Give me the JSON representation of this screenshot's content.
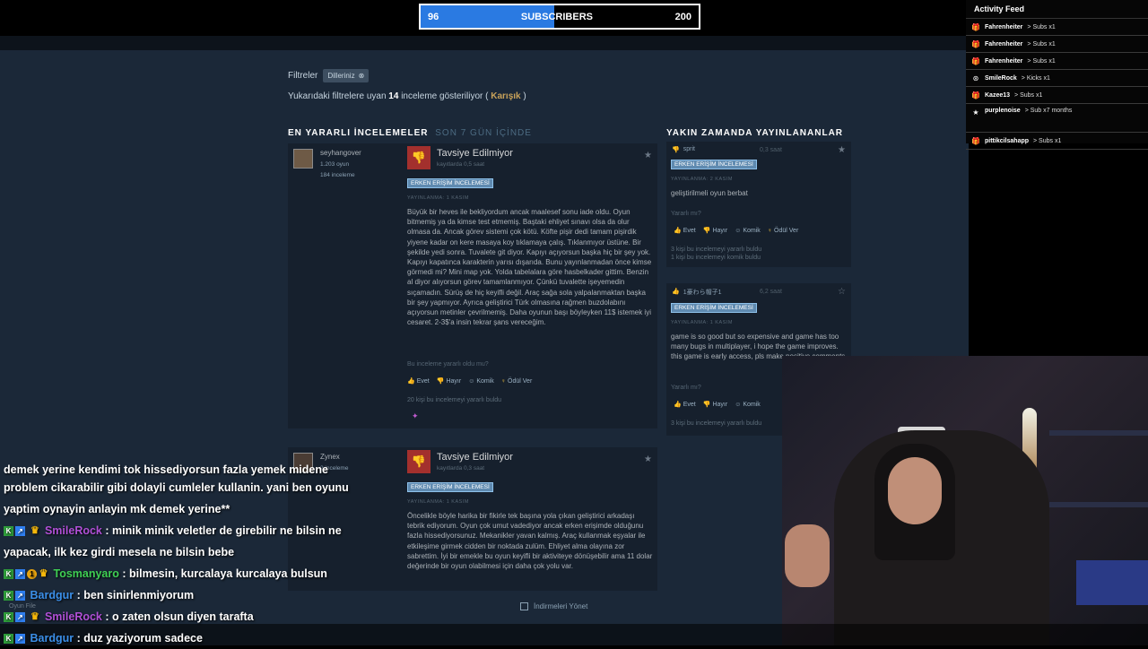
{
  "subscribers": {
    "current": "96",
    "label": "SUBSCRIBERS",
    "goal": "200",
    "progress": 0.48
  },
  "activity_feed": {
    "title": "Activity Feed",
    "items": [
      {
        "user": "Fahrenheiter",
        "action": "> Subs x1",
        "icon": "gift-icon"
      },
      {
        "user": "Fahrenheiter",
        "action": "> Subs x1",
        "icon": "gift-icon"
      },
      {
        "user": "Fahrenheiter",
        "action": "> Subs x1",
        "icon": "gift-icon"
      },
      {
        "user": "SmileRock",
        "action": "> Kicks x1",
        "icon": "kick-icon"
      },
      {
        "user": "Kazee13",
        "action": "> Subs x1",
        "icon": "gift-icon"
      },
      {
        "user": "purplenoise",
        "action": "> Sub x7 months",
        "icon": "star-icon"
      },
      {
        "user": "pittikcilsahapp",
        "action": "> Subs x1",
        "icon": "gift-icon"
      }
    ]
  },
  "filters": {
    "label": "Filtreler",
    "chip": "Dilleriniz",
    "chip_close": "⊗"
  },
  "showing": {
    "prefix": "Yukarıdaki filtrelere uyan",
    "count": "14",
    "suffix": "inceleme gösteriliyor (",
    "mix": "Karışık",
    "close": ")"
  },
  "section_main": {
    "title": "EN YARARLI İNCELEMELER",
    "sub": "SON 7 GÜN İÇİNDE"
  },
  "section_side": {
    "title": "YAKIN ZAMANDA YAYINLANANLAR"
  },
  "reviews": [
    {
      "author": "seyhangover",
      "games": "1.203 oyun",
      "reviews": "184 inceleme",
      "verdict": "Tavsiye Edilmiyor",
      "time": "kayıtlarda 0,5 saat",
      "badge": "ERKEN ERİŞİM İNCELEMESİ",
      "posted": "YAYINLANMA: 1 KASIM",
      "text": "Büyük bir heves ile bekliyordum ancak maalesef sonu iade oldu. Oyun bitmemiş ya da kimse test etmemiş. Baştaki ehliyet sınavı olsa da olur olmasa da. Ancak görev sistemi çok kötü. Köfte pişir dedi tamam pişirdik yiyene kadar on kere masaya koy tıklamaya çalış. Tıklanmıyor üstüne. Bir şekilde yedi sonra. Tuvalete git diyor. Kapıyı açıyorsun başka hiç bir şey yok. Kapıyı kapatınca karakterin yarısı dışarıda. Bunu yayınlanmadan önce kimse görmedi mi? Mini map yok. Yolda tabelalara göre hasbelkader gittim. Benzin al diyor alıyorsun görev tamamlanmıyor. Çünkü tuvalette işeyemedin sıçamadın. Sürüş de hiç keyifli değil. Araç sağa sola yalpalanmaktan başka bir şey yapmıyor. Ayrıca geliştirici Türk olmasına rağmen buzdolabını açıyorsun metinler çevrilmemiş. Daha oyunun başı böyleyken 11$ istemek iyi cesaret. 2-3$'a insin tekrar şans vereceğim.",
      "helpful_q": "Bu inceleme yararlı oldu mu?",
      "buttons": [
        "Evet",
        "Hayır",
        "Komik",
        "Ödül Ver"
      ],
      "found": "20 kişi bu incelemeyi yararlı buldu"
    },
    {
      "author": "Zynex",
      "games": "",
      "reviews": "2 inceleme",
      "verdict": "Tavsiye Edilmiyor",
      "time": "kayıtlarda 0,3 saat",
      "badge": "ERKEN ERİŞİM İNCELEMESİ",
      "posted": "YAYINLANMA: 1 KASIM",
      "text": "Öncelikle böyle harika bir fikirle tek başına yola çıkan geliştirici arkadaşı tebrik ediyorum. Oyun çok umut vadediyor ancak erken erişimde olduğunu fazla hissediyorsunuz. Mekanikler yavan kalmış. Araç kullanmak eşyalar ile etkileşime girmek cidden bir noktada zulüm. Ehliyet alma olayına zor sabrettim. İyi bir emekle bu oyun keyifli bir aktiviteye dönüşebilir ama 11 dolar değerinde bir oyun olabilmesi için daha çok yolu var."
    }
  ],
  "side_reviews": [
    {
      "author": "sprit",
      "time": "0,3 saat",
      "thumb": "down",
      "badge": "ERKEN ERİŞİM İNCELEMESİ",
      "posted": "YAYINLANMA: 2 KASIM",
      "text": "geliştirilmeli oyun berbat",
      "helpful_q": "Yararlı mı?",
      "buttons": [
        "Evet",
        "Hayır",
        "Komik",
        "Ödül Ver"
      ],
      "found": [
        "3 kişi bu incelemeyi yararlı buldu",
        "1 kişi bu incelemeyi komik buldu"
      ]
    },
    {
      "author": "1豪わら帽子1",
      "time": "6,2 saat",
      "thumb": "up",
      "badge": "ERKEN ERİŞİM İNCELEMESİ",
      "posted": "YAYINLANMA: 1 KASIM",
      "text": "game is so good but so expensive and game has too many bugs in multiplayer, i hope the game improves. this game is early access, pls make positive comments",
      "helpful_q": "Yararlı mı?",
      "buttons": [
        "Evet",
        "Hayır",
        "Komik"
      ],
      "found": [
        "3 kişi bu incelemeyi yararlı buldu"
      ]
    }
  ],
  "manage": "İndirmeleri Yönet",
  "oyun_file": "Oyun File",
  "chat": [
    {
      "user": "",
      "text": "demek yerine kendimi tok hissediyorsun fazla yemek midene"
    },
    {
      "user": "",
      "text": "problem cikarabilir gibi dolayli cumleler kullanin. yani ben oyunu"
    },
    {
      "user": "",
      "text": "yaptim oynayin anlayin mk demek yerine**"
    },
    {
      "user": "SmileRock",
      "text": ": minik minik veletler de girebilir ne bilsin ne"
    },
    {
      "user": "",
      "text": "yapacak, ilk kez girdi mesela ne bilsin bebe"
    },
    {
      "user": "Tosmanyaro",
      "text": ": bilmesin, kurcalaya kurcalaya bulsun"
    },
    {
      "user": "Bardgur",
      "text": ": ben sinirlenmiyorum"
    },
    {
      "user": "SmileRock",
      "text": ": o zaten olsun diyen tarafta"
    },
    {
      "user": "Bardgur",
      "text": ": duz yaziyorum sadece"
    }
  ]
}
